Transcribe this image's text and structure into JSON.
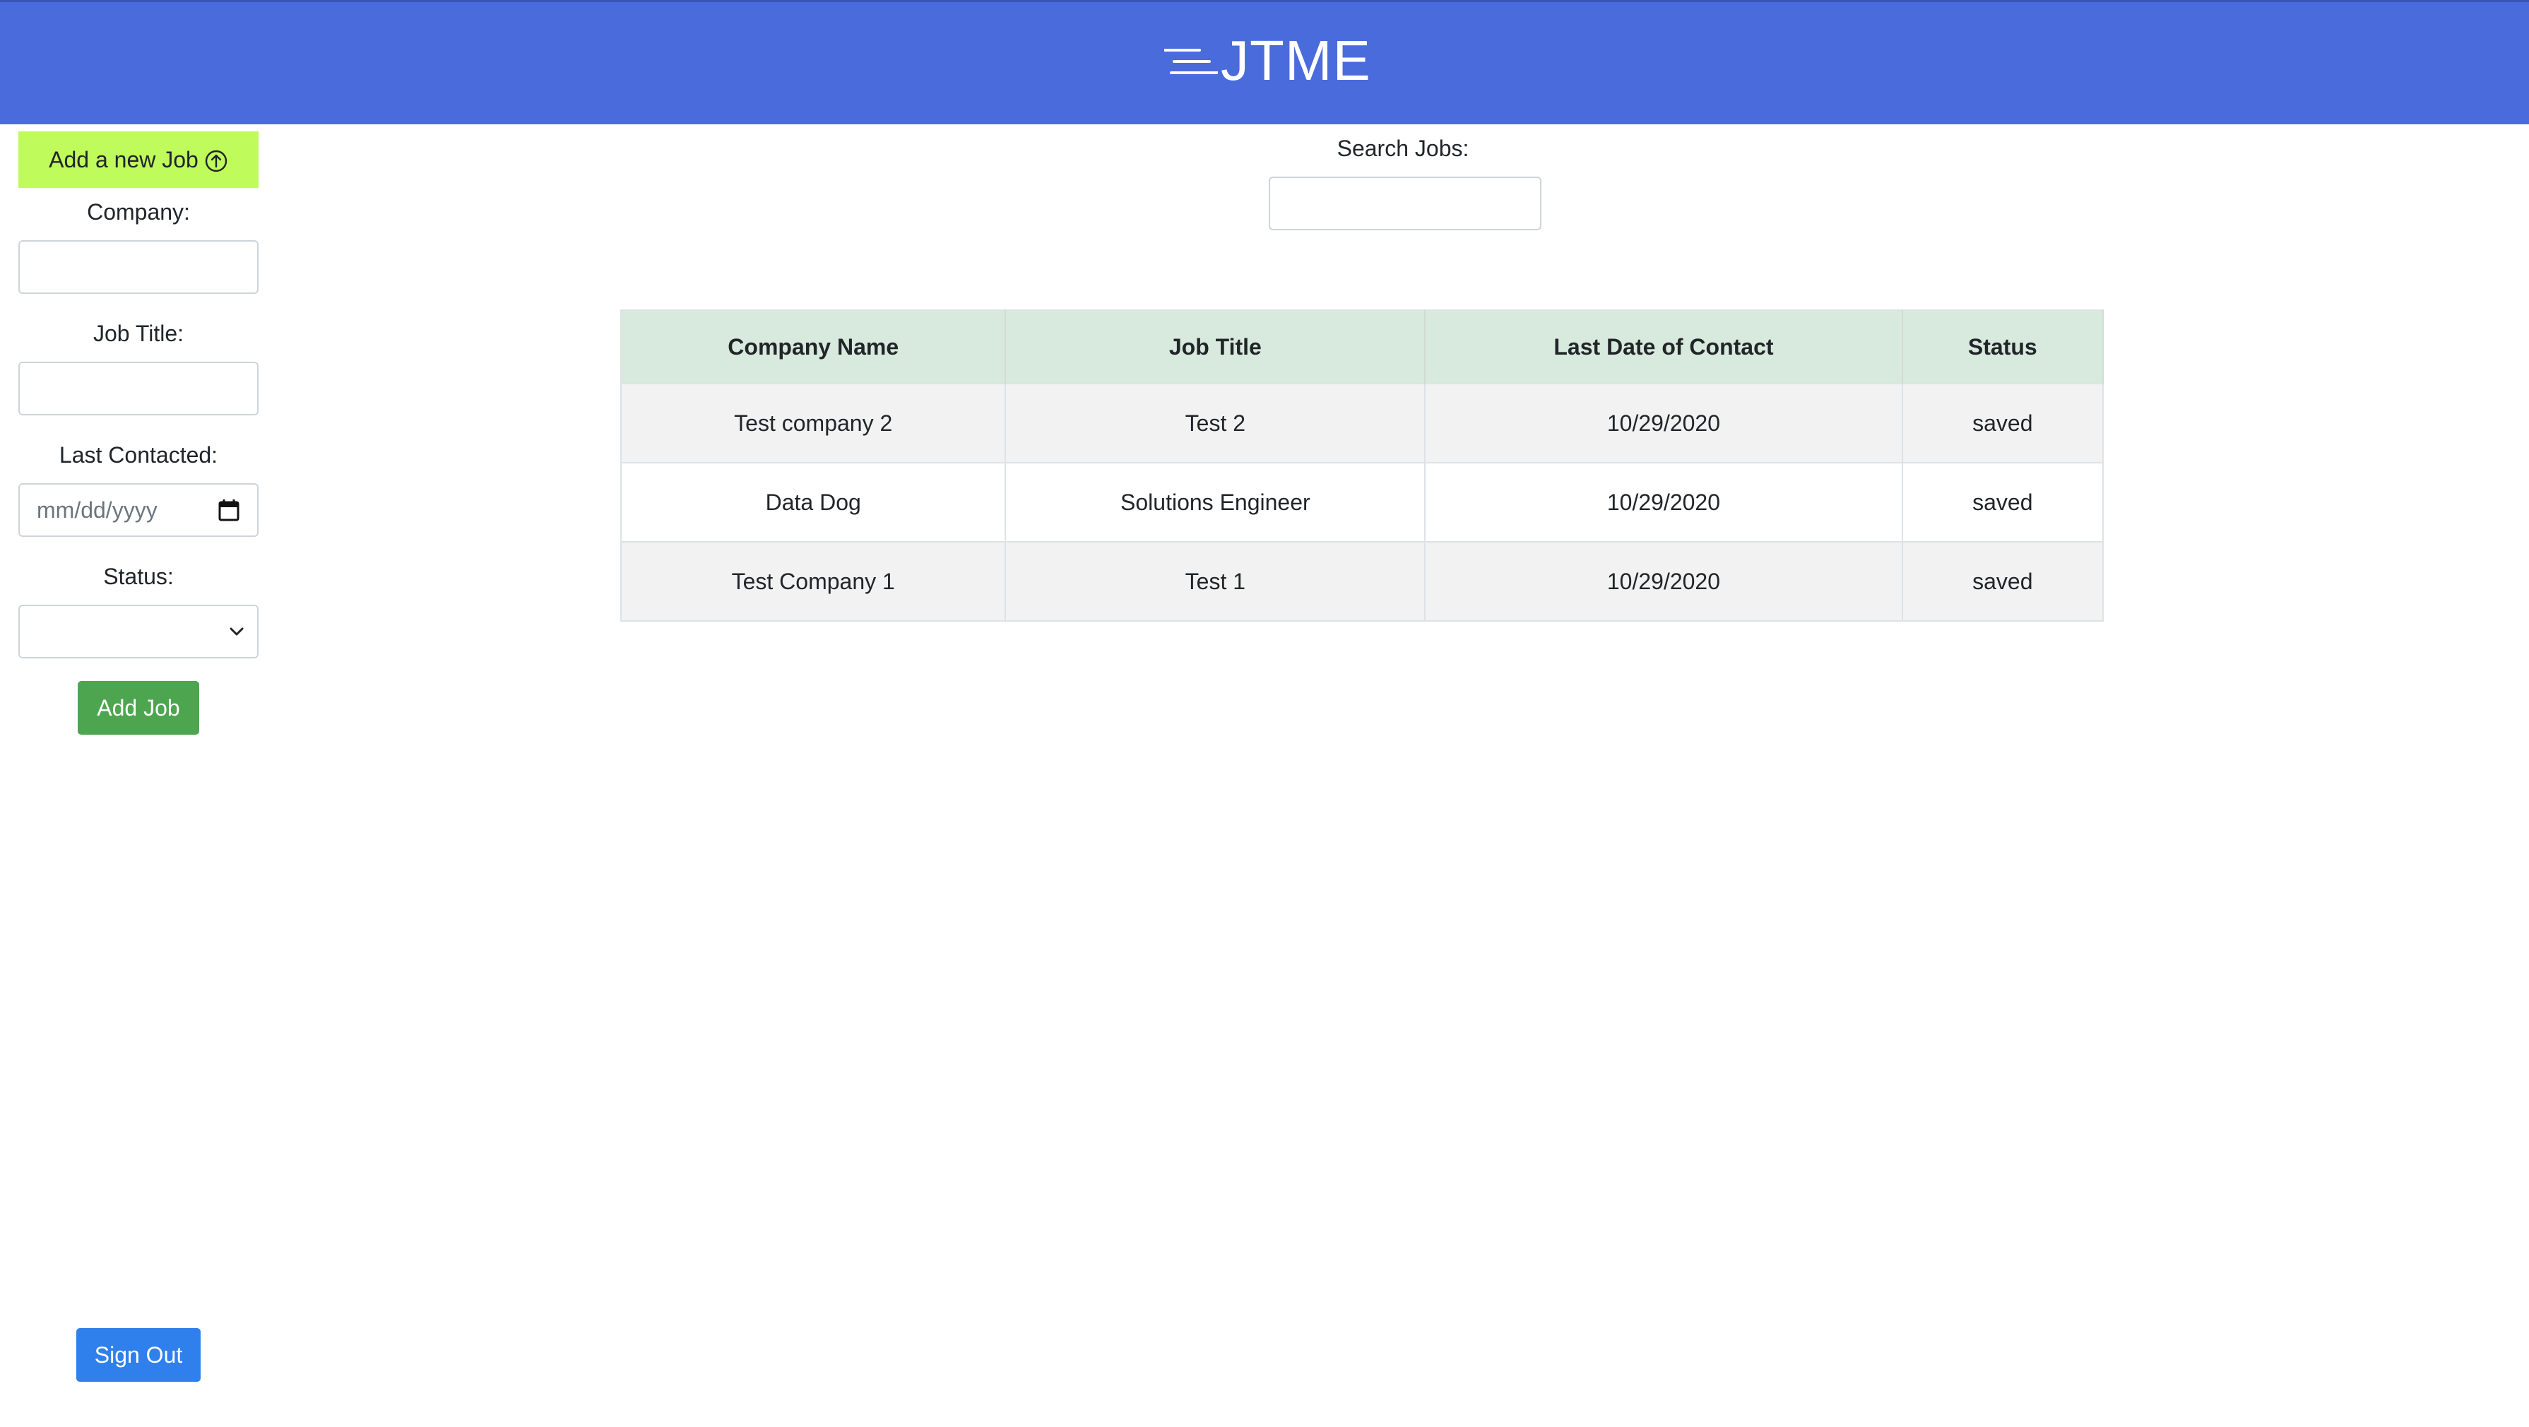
{
  "app": {
    "brand": "JTME",
    "brand_icon": "lines-icon",
    "header_color": "#4a6bdb"
  },
  "sidebar": {
    "add_new_label": "Add a new Job",
    "add_new_icon": "arrow-up-circle-icon",
    "company_label": "Company:",
    "company_value": "",
    "job_title_label": "Job Title:",
    "job_title_value": "",
    "last_contacted_label": "Last Contacted:",
    "last_contacted_placeholder": "mm/dd/yyyy",
    "status_label": "Status:",
    "status_value": "",
    "add_job_label": "Add Job",
    "sign_out_label": "Sign Out"
  },
  "search": {
    "label": "Search Jobs:",
    "value": ""
  },
  "table": {
    "headers": [
      "Company Name",
      "Job Title",
      "Last Date of Contact",
      "Status"
    ],
    "rows": [
      [
        "Test company 2",
        "Test 2",
        "10/29/2020",
        "saved"
      ],
      [
        "Data Dog",
        "Solutions Engineer",
        "10/29/2020",
        "saved"
      ],
      [
        "Test Company 1",
        "Test 1",
        "10/29/2020",
        "saved"
      ]
    ]
  },
  "colors": {
    "add_new_bg": "#bffb5b",
    "add_job_bg": "#4ea550",
    "sign_out_bg": "#2f80ed",
    "table_header_bg": "#d8eadd"
  }
}
